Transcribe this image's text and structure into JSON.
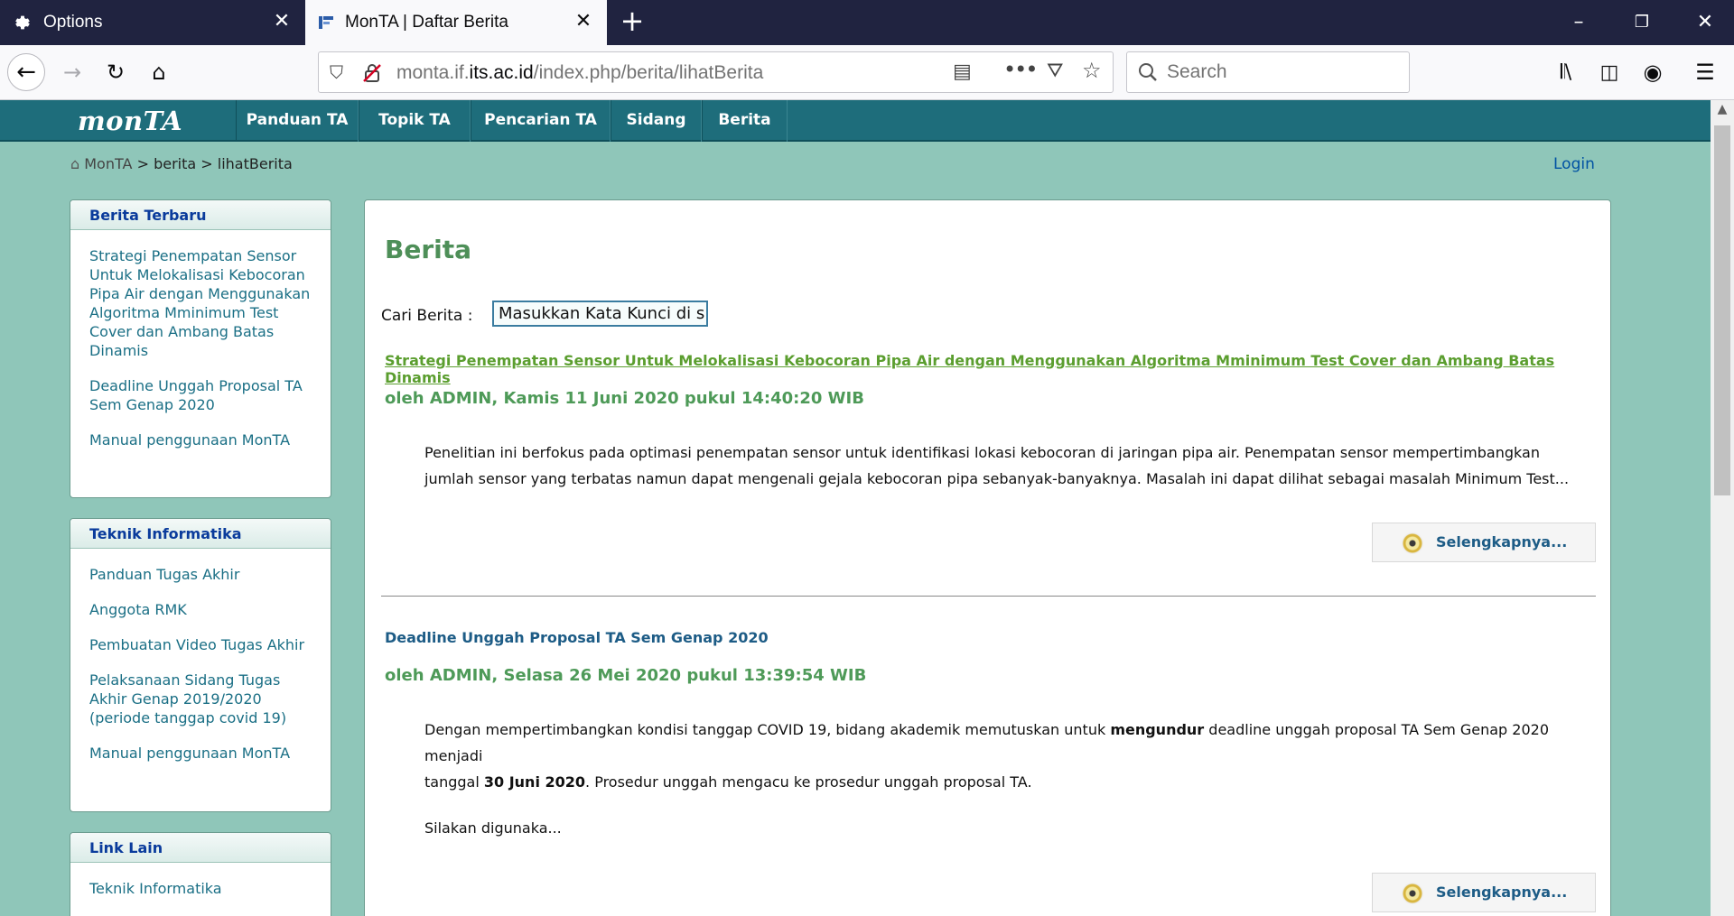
{
  "browser": {
    "tabs": [
      {
        "label": "Options",
        "icon": "gear-icon"
      },
      {
        "label": "MonTA | Daftar Berita",
        "icon": "monta-favicon-icon"
      }
    ],
    "url_prefix": "monta.if.",
    "url_domain": "its.ac.id",
    "url_path": "/index.php/berita/lihatBerita",
    "search_placeholder": "Search"
  },
  "site": {
    "logo": "monTA",
    "menu": [
      "Panduan TA",
      "Topik TA",
      "Pencarian TA",
      "Sidang",
      "Berita"
    ],
    "breadcrumb": [
      "MonTA",
      "berita",
      "lihatBerita"
    ],
    "breadcrumb_separator": ">",
    "login": "Login"
  },
  "sidebar": {
    "berita_terbaru": {
      "title": "Berita Terbaru",
      "items": [
        "Strategi Penempatan Sensor Untuk Melokalisasi Kebocoran Pipa Air dengan Menggunakan Algoritma Mminimum Test Cover dan Ambang Batas Dinamis",
        "Deadline Unggah Proposal TA Sem Genap 2020",
        "Manual penggunaan MonTA"
      ]
    },
    "teknik_informatika": {
      "title": "Teknik Informatika",
      "items": [
        "Panduan Tugas Akhir",
        "Anggota RMK",
        "Pembuatan Video Tugas Akhir",
        "Pelaksanaan Sidang Tugas Akhir Genap 2019/2020 (periode tanggap covid 19)",
        "Manual penggunaan MonTA"
      ]
    },
    "link_lain": {
      "title": "Link Lain",
      "items": [
        "Teknik Informatika"
      ]
    }
  },
  "main": {
    "heading": "Berita",
    "search_label": "Cari Berita :",
    "search_value": "Masukkan Kata Kunci di s",
    "articles": [
      {
        "title": "Strategi Penempatan Sensor Untuk Melokalisasi Kebocoran Pipa Air dengan Menggunakan Algoritma Mminimum Test Cover dan Ambang Batas Dinamis",
        "meta": "oleh ADMIN, Kamis 11 Juni 2020 pukul 14:40:20 WIB",
        "body_line1": "Penelitian ini berfokus pada optimasi penempatan sensor untuk identifikasi lokasi kebocoran di jaringan pipa air. Penempatan sensor mempertimbangkan",
        "body_line2": "jumlah sensor yang terbatas namun dapat mengenali gejala kebocoran pipa sebanyak-banyaknya. Masalah ini dapat dilihat sebagai masalah Minimum Test...",
        "more": "Selengkapnya..."
      },
      {
        "title": "Deadline Unggah Proposal TA Sem Genap 2020",
        "meta": "oleh ADMIN, Selasa 26 Mei 2020 pukul 13:39:54 WIB",
        "body_l1_a": "Dengan mempertimbangkan kondisi tanggap COVID 19, bidang akademik memutuskan untuk ",
        "body_l1_b": "mengundur",
        "body_l1_c": " deadline unggah proposal TA Sem Genap 2020 menjadi",
        "body_l2_a": "tanggal ",
        "body_l2_b": "30 Juni 2020",
        "body_l2_c": ". Prosedur unggah mengacu ke prosedur unggah proposal TA.",
        "body_l3": "Silakan digunaka...",
        "more": "Selengkapnya..."
      }
    ]
  }
}
